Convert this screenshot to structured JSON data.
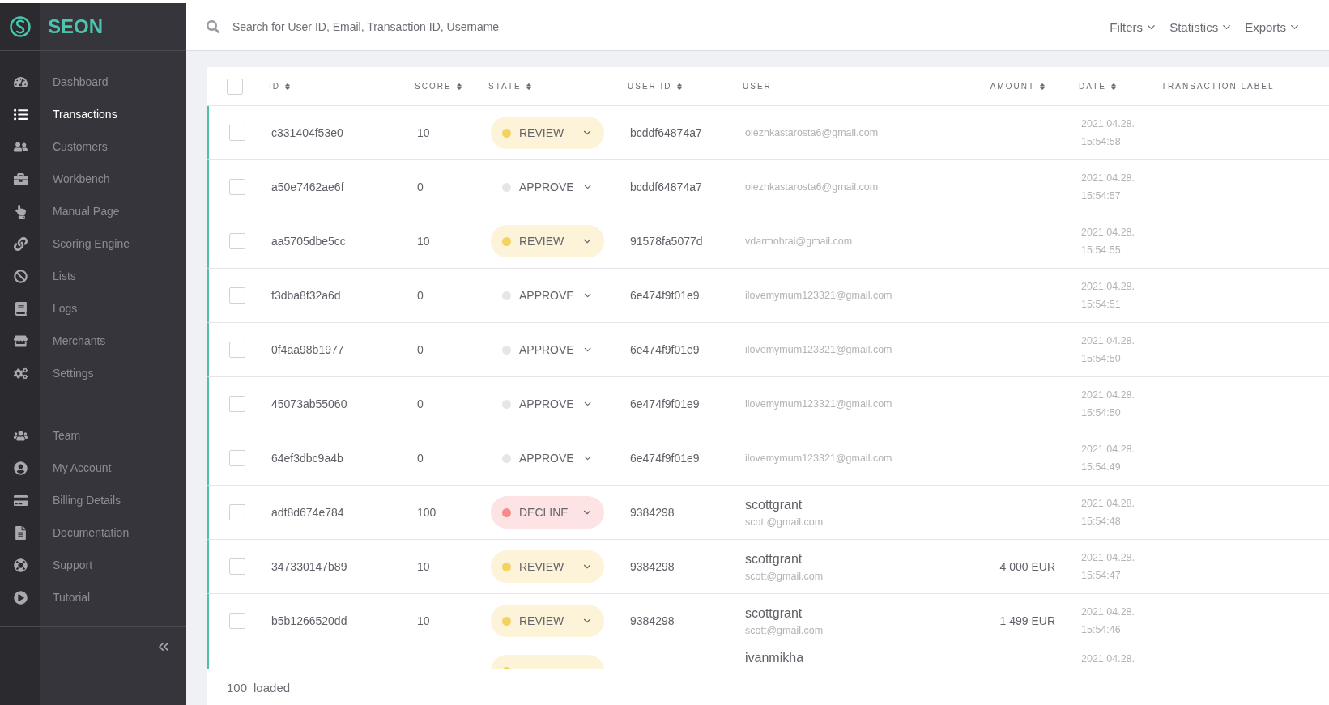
{
  "brand": {
    "name": "SEON"
  },
  "sidebar": {
    "items": [
      {
        "label": "Dashboard",
        "selected": false
      },
      {
        "label": "Transactions",
        "selected": true
      },
      {
        "label": "Customers",
        "selected": false
      },
      {
        "label": "Workbench",
        "selected": false
      },
      {
        "label": "Manual Page",
        "selected": false
      },
      {
        "label": "Scoring Engine",
        "selected": false
      },
      {
        "label": "Lists",
        "selected": false
      },
      {
        "label": "Logs",
        "selected": false
      },
      {
        "label": "Merchants",
        "selected": false
      },
      {
        "label": "Settings",
        "selected": false
      }
    ],
    "account_items": [
      {
        "label": "Team",
        "selected": false
      },
      {
        "label": "My Account",
        "selected": false
      },
      {
        "label": "Billing Details",
        "selected": false
      },
      {
        "label": "Documentation",
        "selected": false
      },
      {
        "label": "Support",
        "selected": false
      },
      {
        "label": "Tutorial",
        "selected": false
      }
    ]
  },
  "search": {
    "placeholder": "Search for User ID, Email, Transaction ID, Username"
  },
  "toolbar": [
    "Filters",
    "Statistics",
    "Exports"
  ],
  "table": {
    "select_all": {
      "checked": false
    },
    "columns": [
      {
        "label": "ID",
        "sortable": true
      },
      {
        "label": "SCORE",
        "sortable": true
      },
      {
        "label": "STATE",
        "sortable": true
      },
      {
        "label": "USER ID",
        "sortable": true
      },
      {
        "label": "USER",
        "sortable": false
      },
      {
        "label": "AMOUNT",
        "sortable": true
      },
      {
        "label": "DATE",
        "sortable": true
      },
      {
        "label": "TRANSACTION LABEL",
        "sortable": false
      }
    ],
    "rows": [
      {
        "checked": false,
        "id": "c331404f53e0",
        "score": "10",
        "state": {
          "kind": "review",
          "label": "REVIEW"
        },
        "user_id": "bcddf64874a7",
        "user": {
          "email": "olezhkastarosta6@gmail.com"
        },
        "date": "2021.04.28.",
        "time": "15:54:58"
      },
      {
        "checked": false,
        "id": "a50e7462ae6f",
        "score": "0",
        "state": {
          "kind": "approve",
          "label": "APPROVE"
        },
        "user_id": "bcddf64874a7",
        "user": {
          "email": "olezhkastarosta6@gmail.com"
        },
        "date": "2021.04.28.",
        "time": "15:54:57"
      },
      {
        "checked": false,
        "id": "aa5705dbe5cc",
        "score": "10",
        "state": {
          "kind": "review",
          "label": "REVIEW"
        },
        "user_id": "91578fa5077d",
        "user": {
          "email": "vdarmohrai@gmail.com"
        },
        "date": "2021.04.28.",
        "time": "15:54:55"
      },
      {
        "checked": false,
        "id": "f3dba8f32a6d",
        "score": "0",
        "state": {
          "kind": "approve",
          "label": "APPROVE"
        },
        "user_id": "6e474f9f01e9",
        "user": {
          "email": "ilovemymum123321@gmail.com"
        },
        "date": "2021.04.28.",
        "time": "15:54:51"
      },
      {
        "checked": false,
        "id": "0f4aa98b1977",
        "score": "0",
        "state": {
          "kind": "approve",
          "label": "APPROVE"
        },
        "user_id": "6e474f9f01e9",
        "user": {
          "email": "ilovemymum123321@gmail.com"
        },
        "date": "2021.04.28.",
        "time": "15:54:50"
      },
      {
        "checked": false,
        "id": "45073ab55060",
        "score": "0",
        "state": {
          "kind": "approve",
          "label": "APPROVE"
        },
        "user_id": "6e474f9f01e9",
        "user": {
          "email": "ilovemymum123321@gmail.com"
        },
        "date": "2021.04.28.",
        "time": "15:54:50"
      },
      {
        "checked": false,
        "id": "64ef3dbc9a4b",
        "score": "0",
        "state": {
          "kind": "approve",
          "label": "APPROVE"
        },
        "user_id": "6e474f9f01e9",
        "user": {
          "email": "ilovemymum123321@gmail.com"
        },
        "date": "2021.04.28.",
        "time": "15:54:49"
      },
      {
        "checked": false,
        "id": "adf8d674e784",
        "score": "100",
        "state": {
          "kind": "decline",
          "label": "DECLINE"
        },
        "user_id": "9384298",
        "user": {
          "name": "scottgrant",
          "email": "scott@gmail.com"
        },
        "date": "2021.04.28.",
        "time": "15:54:48"
      },
      {
        "checked": false,
        "id": "347330147b89",
        "score": "10",
        "state": {
          "kind": "review",
          "label": "REVIEW"
        },
        "user_id": "9384298",
        "user": {
          "name": "scottgrant",
          "email": "scott@gmail.com"
        },
        "amount": "4 000 EUR",
        "date": "2021.04.28.",
        "time": "15:54:47"
      },
      {
        "checked": false,
        "id": "b5b1266520dd",
        "score": "10",
        "state": {
          "kind": "review",
          "label": "REVIEW"
        },
        "user_id": "9384298",
        "user": {
          "name": "scottgrant",
          "email": "scott@gmail.com"
        },
        "amount": "1 499 EUR",
        "date": "2021.04.28.",
        "time": "15:54:46"
      },
      {
        "partial": true,
        "state": {
          "kind": "review"
        },
        "user": {
          "name": "ivanmikha"
        },
        "date": "2021.04.28."
      }
    ]
  },
  "footer": {
    "count": "100",
    "label": "loaded"
  }
}
